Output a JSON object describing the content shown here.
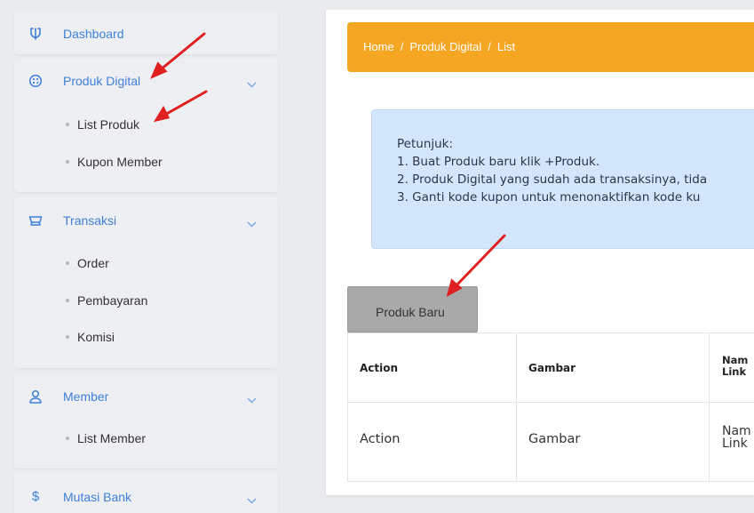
{
  "sidebar": {
    "dashboard": {
      "label": "Dashboard",
      "icon": "dashboard-icon"
    },
    "produk_digital": {
      "label": "Produk Digital",
      "icon": "palette-icon",
      "items": [
        {
          "label": "List Produk"
        },
        {
          "label": "Kupon Member"
        }
      ]
    },
    "transaksi": {
      "label": "Transaksi",
      "icon": "cart-icon",
      "items": [
        {
          "label": "Order"
        },
        {
          "label": "Pembayaran"
        },
        {
          "label": "Komisi"
        }
      ]
    },
    "member": {
      "label": "Member",
      "icon": "user-icon",
      "items": [
        {
          "label": "List Member"
        }
      ]
    },
    "mutasi_bank": {
      "label": "Mutasi Bank",
      "icon": "dollar-icon"
    }
  },
  "breadcrumb": {
    "home": "Home",
    "section": "Produk Digital",
    "page": "List",
    "separator": "/"
  },
  "info": {
    "title": "Petunjuk:",
    "lines": [
      "1. Buat Produk baru klik +Produk.",
      "2. Produk Digital yang sudah ada transaksinya, tida",
      "3. Ganti kode kupon untuk menonaktifkan kode ku"
    ]
  },
  "new_product_button": "Produk Baru",
  "table": {
    "headers": [
      "Action",
      "Gambar",
      "Nam",
      "Link"
    ],
    "row": [
      "Action",
      "Gambar",
      "Nam",
      "Link"
    ]
  },
  "colors": {
    "accent": "#3f7fd9",
    "breadcrumb_bg": "#f5a623",
    "info_bg": "#d4e6fb",
    "button_bg": "#a9a9a9",
    "arrow": "#e02020"
  }
}
